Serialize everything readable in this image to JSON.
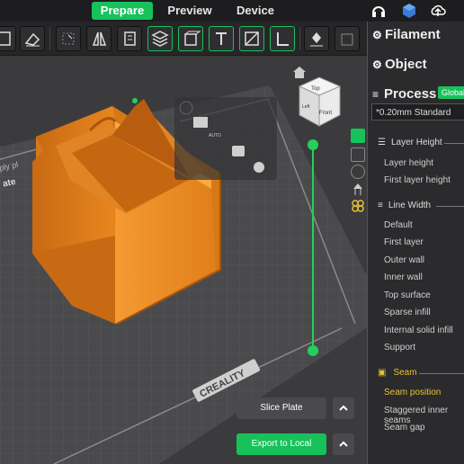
{
  "tabs": {
    "prepare": "Prepare",
    "preview": "Preview",
    "device": "Device"
  },
  "toolbar_icons": [
    "add-icon",
    "erase-icon",
    "auto-orient-icon",
    "arrange-icon",
    "split-icon",
    "layer-icon",
    "cube-icon",
    "text-icon",
    "cut-icon",
    "measure-icon",
    "support-paint-icon",
    "seam-paint-icon"
  ],
  "panel": {
    "filament": "Filament",
    "object": "Object",
    "process": "Process",
    "global_badge": "Global",
    "preset": "*0.20mm Standard",
    "groups": [
      {
        "title": "Layer Height",
        "items": [
          "Layer height",
          "First layer height"
        ]
      },
      {
        "title": "Line Width",
        "items": [
          "Default",
          "First layer",
          "Outer wall",
          "Inner wall",
          "Top surface",
          "Sparse infill",
          "Internal solid infill",
          "Support"
        ]
      },
      {
        "title": "Seam",
        "items": [
          "Seam position",
          "Staggered inner seams",
          "Seam gap"
        ]
      }
    ]
  },
  "buttons": {
    "slice": "Slice Plate",
    "export": "Export to Local"
  },
  "viewcube": {
    "top": "Top",
    "front": "Front",
    "left": "Left"
  },
  "plate_labels": {
    "brand": "CREALITY",
    "plate_left": "ply pl",
    "plate_left2": "ate"
  },
  "colors": {
    "accent": "#17c25a",
    "model": "#f0922a",
    "seam": "#e8c230",
    "bed": "#464649"
  }
}
